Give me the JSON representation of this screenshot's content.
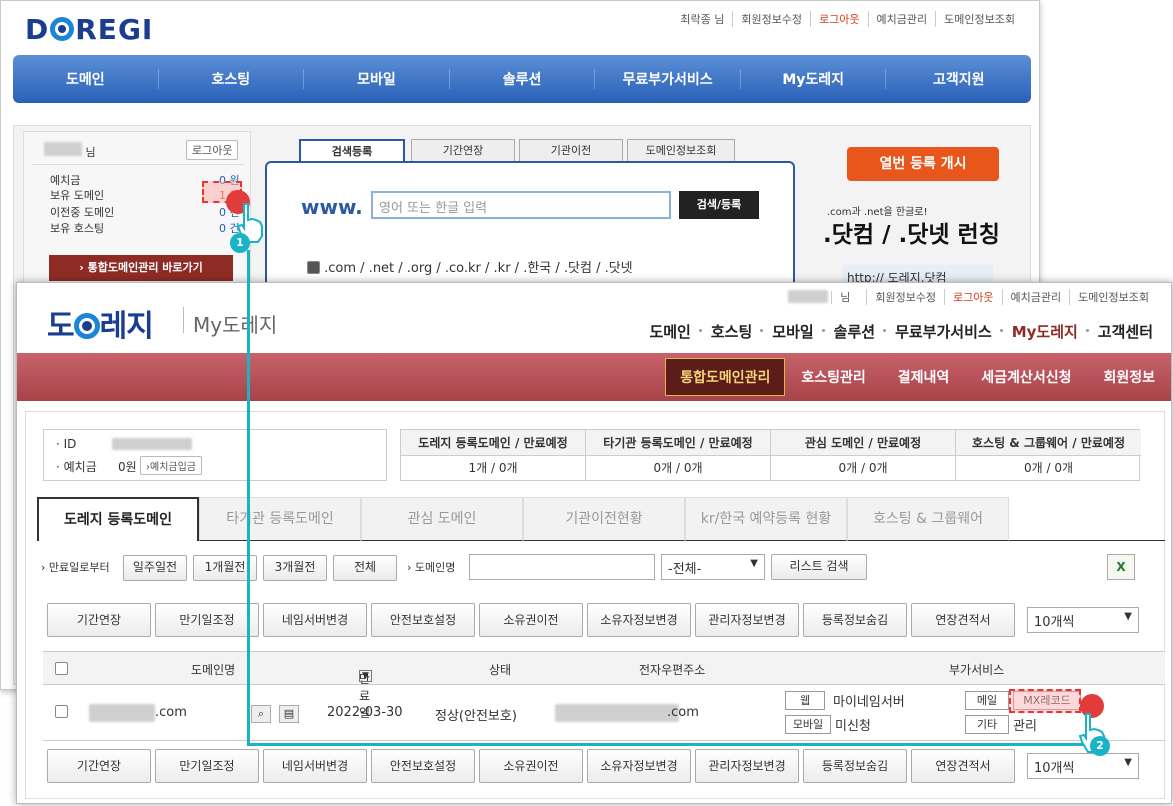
{
  "back": {
    "logo": "DOREGI",
    "toplinks": [
      "최락종 님",
      "회원정보수정",
      "로그아웃",
      "예치금관리",
      "도메인정보조회"
    ],
    "nav": [
      "도메인",
      "호스팅",
      "모바일",
      "솔루션",
      "무료부가서비스",
      "My도레지",
      "고객지원"
    ],
    "user": {
      "suffix": "님",
      "logout": "로그아웃"
    },
    "stats": [
      {
        "label": "예치금",
        "value": "0 원"
      },
      {
        "label": "보유 도메인",
        "value": "1 건"
      },
      {
        "label": "이전중 도메인",
        "value": "0 건"
      },
      {
        "label": "보유 호스팅",
        "value": "0 건"
      }
    ],
    "shortcut": "› 통합도메인관리 바로가기",
    "tabs": [
      "검색등록",
      "기간연장",
      "기관이전",
      "도메인정보조회"
    ],
    "www": "www.",
    "search_placeholder": "영어 또는 한글 입력",
    "search_button": "검색/등록",
    "tlds": ".com / .net / .org / .co.kr / .kr / .한국 / .닷컴 / .닷넷",
    "banner": {
      "badge": "열번 등록 개시",
      "sub": ".com과 .net을 한글로!",
      "big": ".닷컴 / .닷넷 런칭",
      "url": "http:// 도레지.닷컴"
    }
  },
  "front": {
    "logo_sub": "My도레지",
    "toplinks": [
      "님",
      "회원정보수정",
      "로그아웃",
      "예치금관리",
      "도메인정보조회"
    ],
    "menu": [
      "도메인",
      "호스팅",
      "모바일",
      "솔루션",
      "무료부가서비스",
      "My도레지",
      "고객센터"
    ],
    "submenu": [
      "통합도메인관리",
      "호스팅관리",
      "결제내역",
      "세금계산서신청",
      "회원정보"
    ],
    "info": {
      "id_label": "ID",
      "deposit_label": "예치금",
      "deposit_value": "0원",
      "deposit_btn": "›예치금입금"
    },
    "stats_headers": [
      "도레지 등록도메인 / 만료예정",
      "타기관 등록도메인 / 만료예정",
      "관심 도메인 / 만료예정",
      "호스팅 & 그룹웨어 / 만료예정"
    ],
    "stats_values": [
      "1개 / 0개",
      "0개 / 0개",
      "0개 / 0개",
      "0개 / 0개"
    ],
    "tabs": [
      "도레지 등록도메인",
      "타기관 등록도메인",
      "관심 도메인",
      "기관이전현황",
      "kr/한국 예약등록 현황",
      "호스팅 & 그룹웨어"
    ],
    "filter": {
      "period_label": "만료일로부터",
      "periods": [
        "일주일전",
        "1개월전",
        "3개월전",
        "전체"
      ],
      "domain_label": "도메인명",
      "select": "-전체-",
      "search_btn": "리스트 검색"
    },
    "actions": [
      "기간연장",
      "만기일조정",
      "네임서버변경",
      "안전보호설정",
      "소유권이전",
      "소유자정보변경",
      "관리자정보변경",
      "등록정보숨김",
      "연장견적서"
    ],
    "per_page": "10개씩",
    "columns": [
      "도메인명",
      "만료일",
      "상태",
      "전자우편주소",
      "부가서비스"
    ],
    "row": {
      "domain": ".com",
      "expiry": "2022-03-30",
      "status": "정상(안전보호)",
      "email": ".com",
      "svc": [
        {
          "btn": "웹",
          "text": "마이네임서버"
        },
        {
          "btn": "모바일",
          "text": "미신청"
        },
        {
          "btn": "메일",
          "text": ""
        },
        {
          "btn": "MX레코드",
          "text": ""
        },
        {
          "btn": "기타",
          "text": "관리"
        }
      ]
    }
  },
  "callouts": [
    "1",
    "2"
  ],
  "colors": {
    "brand_blue": "#2a61b8",
    "accent_red": "#a9434a",
    "callout": "#18b3c6"
  }
}
